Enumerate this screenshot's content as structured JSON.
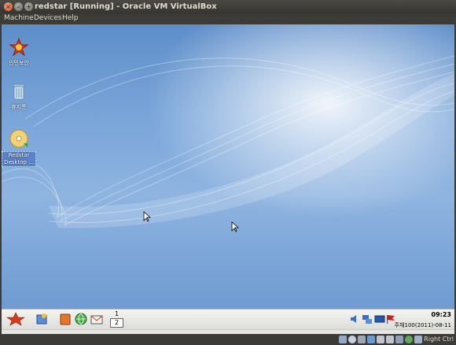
{
  "window": {
    "title": "redstar [Running] - Oracle VM VirtualBox"
  },
  "menu": {
    "items": [
      "Machine",
      "Devices",
      "Help"
    ]
  },
  "desktop_icons": [
    {
      "label": "인민보안",
      "icon": "redstar-home-icon"
    },
    {
      "label": "휴지통",
      "icon": "trash-icon"
    },
    {
      "label": "Redstar Desktop ...",
      "icon": "cd-drive-icon"
    }
  ],
  "taskbar": {
    "pager": [
      "1",
      "2"
    ],
    "active_desktop": "2",
    "clock": "09:23",
    "date": "주체100(2011)-08-11",
    "launchers": [
      "redstar-menu-icon",
      "paint-icon",
      "office-icon",
      "browser-globe-icon",
      "email-icon"
    ],
    "tray": [
      "volume-icon",
      "network-icon",
      "keyboard-icon",
      "flag-icon"
    ]
  },
  "statusbar": {
    "host_key": "Right Ctrl",
    "icons": [
      "hard-disk-icon",
      "cd-icon",
      "usb-icon",
      "network-status-icon",
      "shared-folder-icon",
      "display-icon",
      "capture-icon",
      "mouse-integration-icon",
      "keyboard-capture-icon"
    ]
  },
  "colors": {
    "accent": "#df4a16",
    "desktop": "#7ba6da",
    "chrome": "#3c3b37"
  }
}
